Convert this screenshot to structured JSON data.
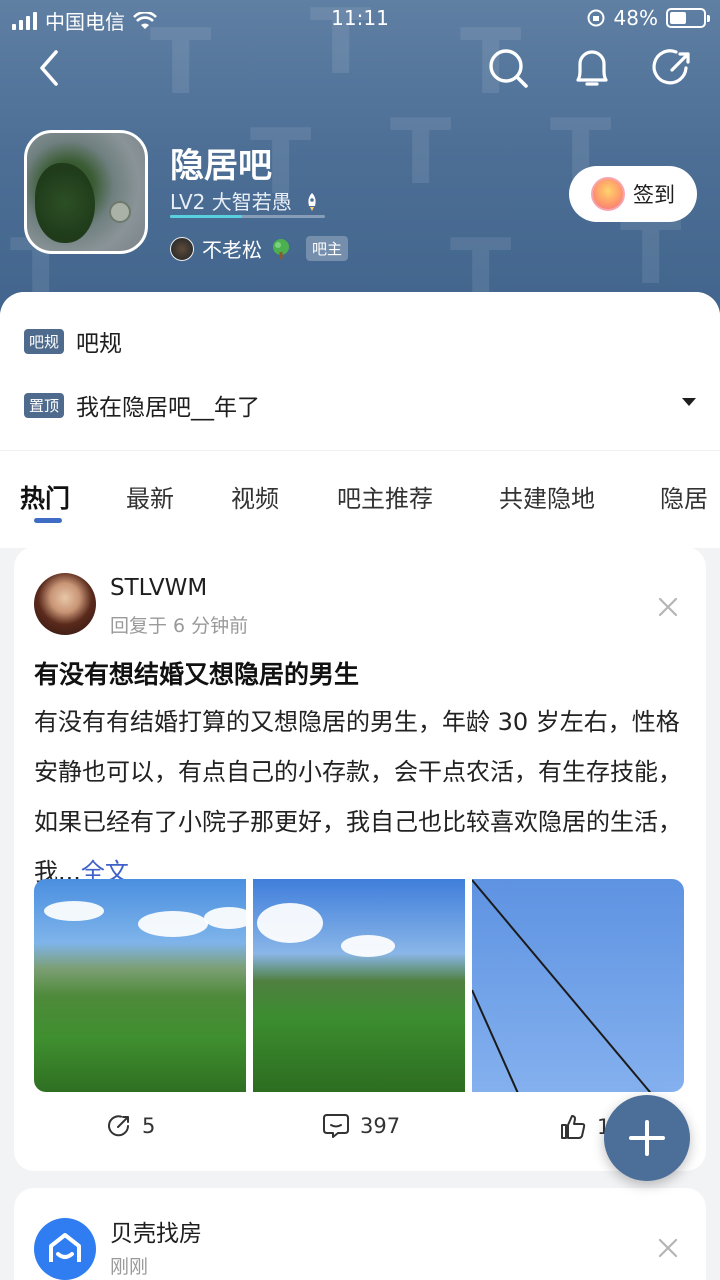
{
  "status_bar": {
    "carrier": "中国电信",
    "time": "11:11",
    "battery": "48%"
  },
  "forum": {
    "name": "隐居吧",
    "level": "LV2 大智若愚",
    "level_progress": 0.46,
    "owner_name": "不老松",
    "owner_badge": "吧主",
    "signin_label": "签到"
  },
  "notices": [
    {
      "tag": "吧规",
      "text": "吧规"
    },
    {
      "tag": "置顶",
      "text": "我在隐居吧__年了"
    }
  ],
  "tabs": [
    "热门",
    "最新",
    "视频",
    "吧主推荐",
    "共建隐地",
    "隐居"
  ],
  "active_tab": "热门",
  "post": {
    "username": "STLVWM",
    "meta": "回复于 6 分钟前",
    "title": "有没有想结婚又想隐居的男生",
    "body": "有没有有结婚打算的又想隐居的男生，年龄 30 岁左右，性格安静也可以，有点自己的小存款，会干点农活，有生存技能，如果已经有了小院子那更好，我自己也比较喜欢隐居的生活，我...",
    "more_label": "全文",
    "share_count": "5",
    "comment_count": "397",
    "like_count": "1"
  },
  "ad": {
    "name": "贝壳找房",
    "meta": "刚刚"
  },
  "colors": {
    "header": "#4d6f96",
    "accent": "#3f61c8",
    "tag": "#4e6a8c",
    "fab": "#4c6f9a"
  }
}
